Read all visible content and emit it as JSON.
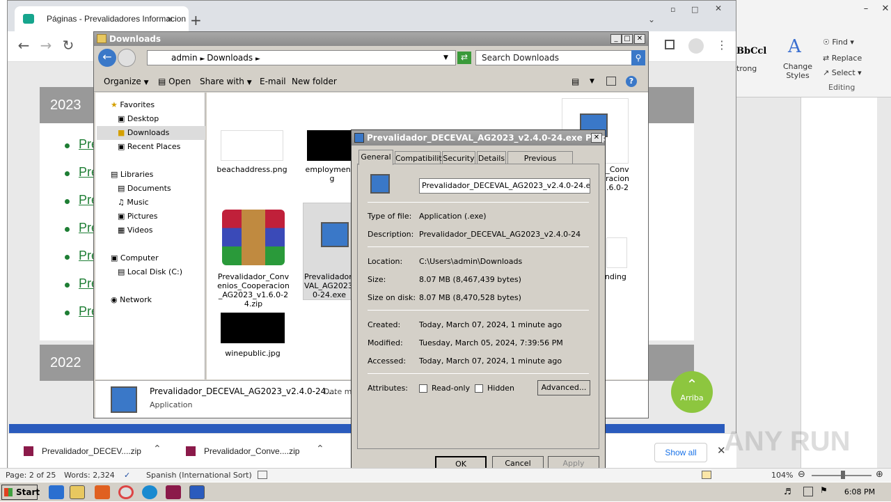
{
  "word": {
    "ribbon": {
      "styles_sample": "BbCcl",
      "styles_name": "trong",
      "change_styles": "Change Styles",
      "find": "Find",
      "replace": "Replace",
      "select": "Select",
      "editing": "Editing"
    },
    "status": {
      "page": "Page: 2 of 25",
      "words": "Words: 2,324",
      "language": "Spanish (International Sort)",
      "zoom": "104%"
    }
  },
  "chrome": {
    "tab_title": "Páginas - Prevalidadores Informacion",
    "years": [
      "2023",
      "2022"
    ],
    "bullet_text": "Pre",
    "arriba_label": "Arriba",
    "downloads": [
      {
        "name": "Prevalidador_DECEV....zip"
      },
      {
        "name": "Prevalidador_Conve....zip"
      }
    ],
    "show_all": "Show all"
  },
  "explorer": {
    "title": "Downloads",
    "path": [
      "admin",
      "Downloads"
    ],
    "search_placeholder": "Search Downloads",
    "commands": {
      "organize": "Organize",
      "open": "Open",
      "share": "Share with",
      "email": "E-mail",
      "new_folder": "New folder"
    },
    "nav": {
      "favorites": "Favorites",
      "desktop": "Desktop",
      "downloads": "Downloads",
      "recent": "Recent Places",
      "libraries": "Libraries",
      "documents": "Documents",
      "music": "Music",
      "pictures": "Pictures",
      "videos": "Videos",
      "computer": "Computer",
      "local_disk": "Local Disk (C:)",
      "network": "Network"
    },
    "files": {
      "f1": "beachaddress.png",
      "f2a": "employmentit",
      "f2b": "g",
      "f3a": "Prevalidador_Conv",
      "f3b": "enios_Cooperacion",
      "f3c": "_AG2023_v1.6.0-2",
      "f3d": "4.zip",
      "f4a": "Prevalidador_",
      "f4b": "VAL_AG2023_",
      "f4c": "0-24.exe",
      "f5": "winepublic.jpg",
      "f6a": "_Conv",
      "f6b": "racion",
      "f6c": ".6.0-2",
      "f7": "ending"
    },
    "status": {
      "name": "Prevalidador_DECEVAL_AG2023_v2.4.0-24....",
      "date": "Date mo",
      "type": "Application"
    }
  },
  "props": {
    "title": "Prevalidador_DECEVAL_AG2023_v2.4.0-24.exe Properti...",
    "tabs": [
      "General",
      "Compatibility",
      "Security",
      "Details",
      "Previous Versions"
    ],
    "filename": "Prevalidador_DECEVAL_AG2023_v2.4.0-24.exe",
    "type_lbl": "Type of file:",
    "type_val": "Application (.exe)",
    "desc_lbl": "Description:",
    "desc_val": "Prevalidador_DECEVAL_AG2023_v2.4.0-24",
    "loc_lbl": "Location:",
    "loc_val": "C:\\Users\\admin\\Downloads",
    "size_lbl": "Size:",
    "size_val": "8.07 MB (8,467,439 bytes)",
    "disk_lbl": "Size on disk:",
    "disk_val": "8.07 MB (8,470,528 bytes)",
    "created_lbl": "Created:",
    "created_val": "Today, March 07, 2024, 1 minute ago",
    "modified_lbl": "Modified:",
    "modified_val": "Tuesday, March 05, 2024, 7:39:56 PM",
    "accessed_lbl": "Accessed:",
    "accessed_val": "Today, March 07, 2024, 1 minute ago",
    "attr_lbl": "Attributes:",
    "readonly": "Read-only",
    "hidden": "Hidden",
    "advanced": "Advanced...",
    "ok": "OK",
    "cancel": "Cancel",
    "apply": "Apply"
  },
  "taskbar": {
    "start": "Start",
    "time": "6:08 PM"
  },
  "watermark": "ANY RUN"
}
